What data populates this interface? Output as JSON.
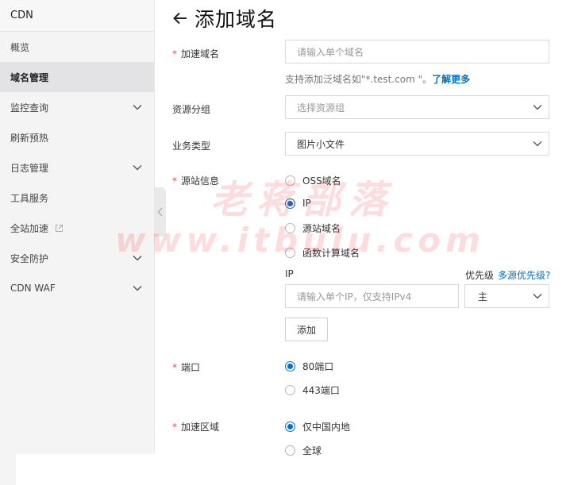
{
  "sidebar": {
    "title": "CDN",
    "items": [
      {
        "label": "概览"
      },
      {
        "label": "域名管理"
      },
      {
        "label": "监控查询"
      },
      {
        "label": "刷新预热"
      },
      {
        "label": "日志管理"
      },
      {
        "label": "工具服务"
      },
      {
        "label": "全站加速"
      },
      {
        "label": "安全防护"
      },
      {
        "label": "CDN WAF"
      }
    ]
  },
  "header": {
    "title": "添加域名"
  },
  "form": {
    "domain": {
      "required": "*",
      "label": "加速域名",
      "placeholder": "请输入单个域名",
      "hint": "支持添加泛域名如\"*.test.com \"。",
      "hint_link": "了解更多"
    },
    "resource_group": {
      "label": "资源分组",
      "placeholder": "选择资源组"
    },
    "business_type": {
      "label": "业务类型",
      "value": "图片小文件"
    },
    "origin": {
      "required": "*",
      "label": "源站信息",
      "options": [
        "OSS域名",
        "IP",
        "源站域名",
        "函数计算域名"
      ],
      "selected": "IP",
      "ip_label": "IP",
      "priority_label": "优先级",
      "priority_link": "多源优先级?",
      "ip_placeholder": "请输入单个IP，仅支持IPv4",
      "priority_value": "主",
      "add_button": "添加"
    },
    "port": {
      "required": "*",
      "label": "端口",
      "options": [
        "80端口",
        "443端口"
      ],
      "selected": "80端口"
    },
    "region": {
      "required": "*",
      "label": "加速区域",
      "options": [
        "仅中国内地",
        "全球"
      ],
      "selected": "仅中国内地"
    }
  },
  "watermark": {
    "line1": "老蒋部落",
    "line2": "www.itbulu.com"
  },
  "colors": {
    "accent": "#0070cc",
    "required": "#e54d42",
    "watermark": "#eb2828"
  }
}
